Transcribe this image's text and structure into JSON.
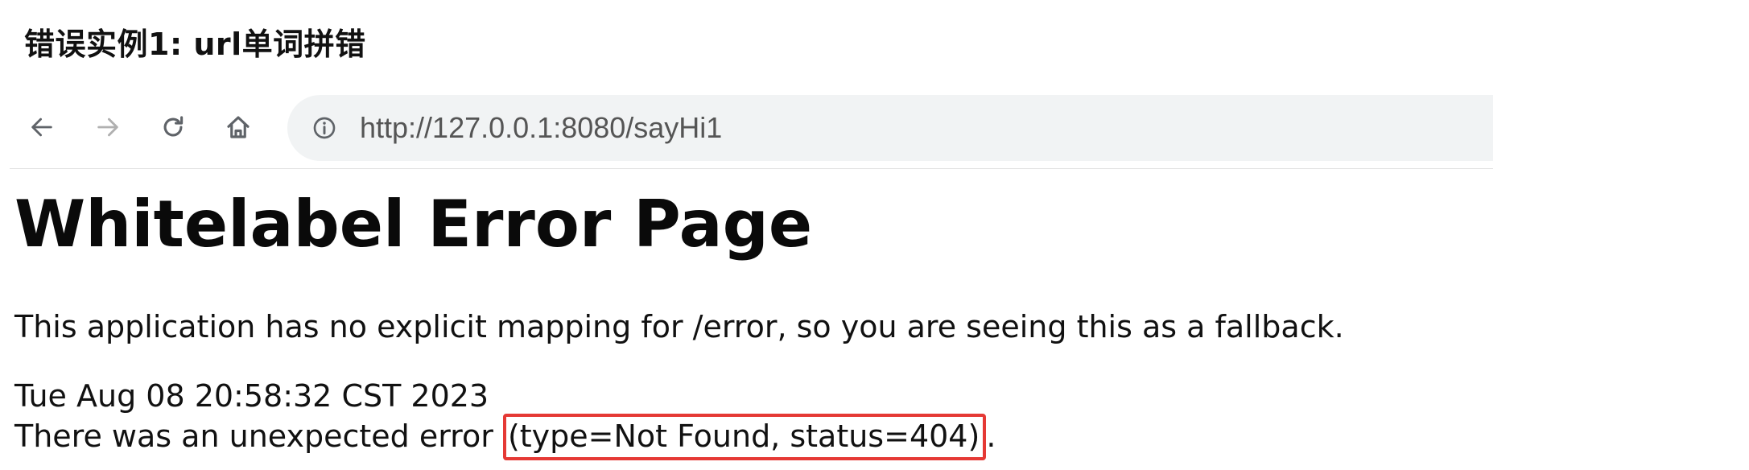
{
  "caption": "错误实例1: url单词拼错",
  "browser": {
    "back_icon": "arrow-left-icon",
    "forward_icon": "arrow-right-icon",
    "reload_icon": "reload-icon",
    "home_icon": "home-icon",
    "info_icon": "info-icon",
    "url": "http://127.0.0.1:8080/sayHi1"
  },
  "page": {
    "title": "Whitelabel Error Page",
    "description": "This application has no explicit mapping for /error, so you are seeing this as a fallback.",
    "timestamp": "Tue Aug 08 20:58:32 CST 2023",
    "error_prefix": "There was an unexpected error ",
    "error_detail": "(type=Not Found, status=404)",
    "error_suffix": "."
  },
  "colors": {
    "highlight_border": "#e53935",
    "address_bar_bg": "#f1f3f4",
    "forward_disabled": "#b0b0b0"
  }
}
